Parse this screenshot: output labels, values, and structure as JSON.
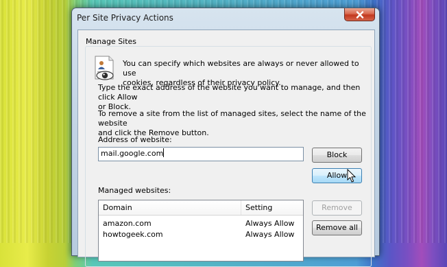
{
  "window": {
    "title": "Per Site Privacy Actions",
    "close_icon": "close-icon"
  },
  "group": {
    "title": "Manage Sites",
    "icon": "privacy-icon",
    "intro_line1": "You can specify which websites are always or never allowed to use",
    "intro_line2": "cookies, regardless of their privacy policy.",
    "instructions_line1": "Type the exact address of the website you want to manage, and then click Allow",
    "instructions_line2": "or Block.",
    "remove_line1": "To remove a site from the list of managed sites, select the name of the website",
    "remove_line2": "and click the Remove button.",
    "address_label": "Address of website:",
    "address_value": "mail.google.com",
    "managed_label": "Managed websites:"
  },
  "buttons": {
    "block": "Block",
    "allow": "Allow",
    "remove": "Remove",
    "remove_all": "Remove all"
  },
  "list": {
    "columns": [
      "Domain",
      "Setting"
    ],
    "rows": [
      {
        "domain": "amazon.com",
        "setting": "Always Allow"
      },
      {
        "domain": "howtogeek.com",
        "setting": "Always Allow"
      }
    ]
  }
}
